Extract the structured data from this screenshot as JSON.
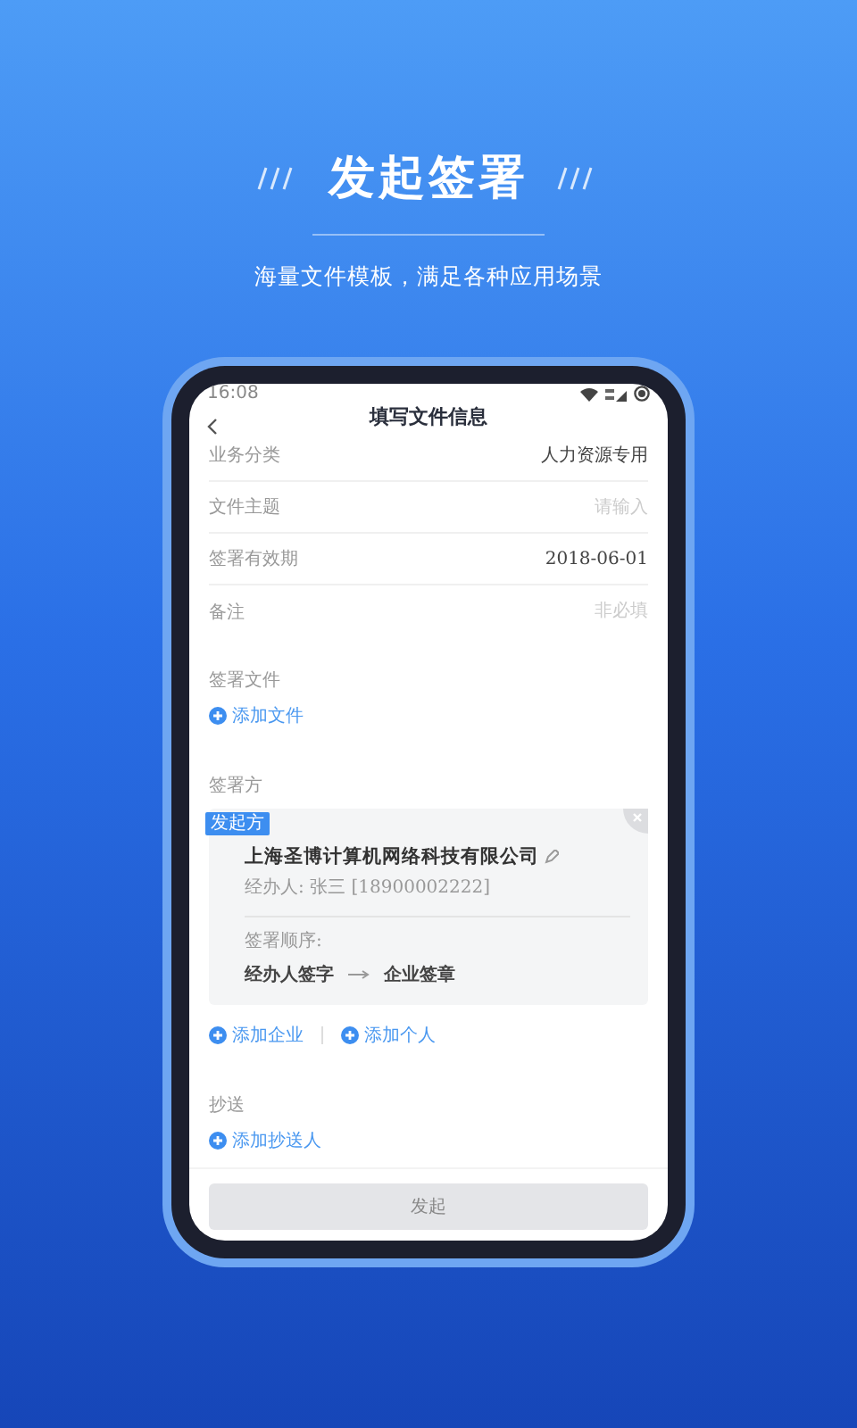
{
  "headline": "发起签署",
  "subtitle": "海量文件模板，满足各种应用场景",
  "status_bar": {
    "time": "16:08"
  },
  "header": {
    "title": "填写文件信息"
  },
  "form_rows": [
    {
      "label": "业务分类",
      "value": "人力资源专用"
    },
    {
      "label": "文件主题",
      "placeholder": "请输入"
    },
    {
      "label": "签署有效期",
      "value": "2018-06-01"
    },
    {
      "label": "备注",
      "placeholder": "非必填"
    }
  ],
  "documents": {
    "title": "签署文件",
    "actions": [
      "添加文件"
    ]
  },
  "signers": {
    "title": "签署方",
    "cards": [
      {
        "badge": "发起方",
        "company": "上海圣博计算机网络科技有限公司",
        "handler": "经办人: 张三 [18900002222]",
        "order_label": "签署顺序:",
        "steps": [
          "经办人签字",
          "企业签章"
        ]
      }
    ],
    "actions": [
      "添加企业",
      "添加个人"
    ]
  },
  "cc": {
    "title": "抄送",
    "actions": [
      "添加抄送人"
    ]
  },
  "submit": {
    "label": "发起",
    "disabled": true
  }
}
